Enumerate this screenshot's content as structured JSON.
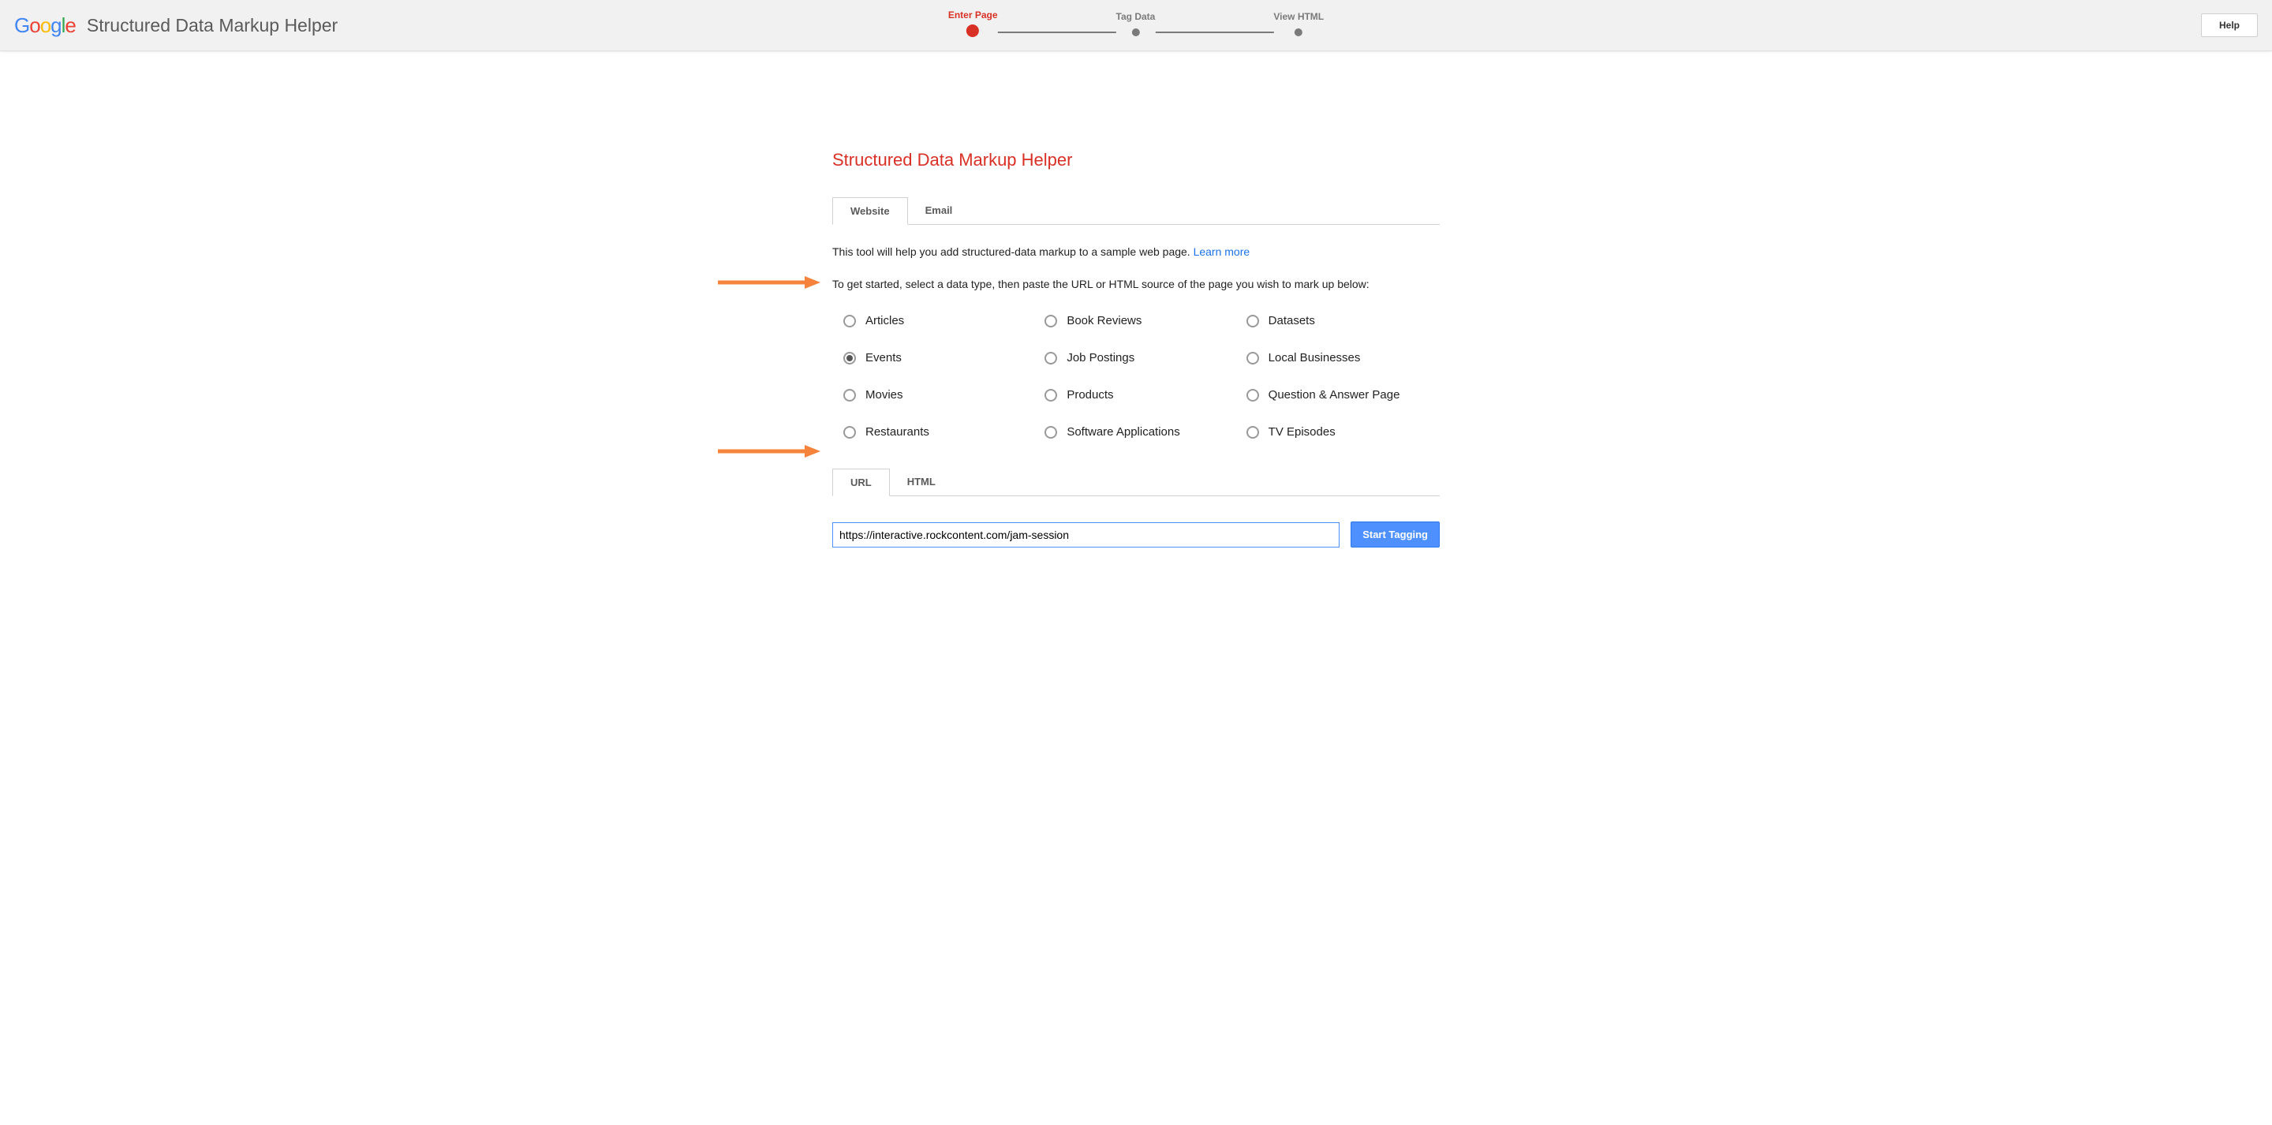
{
  "header": {
    "logo_text": "Google",
    "app_title": "Structured Data Markup Helper",
    "help_label": "Help"
  },
  "steps": [
    {
      "label": "Enter Page",
      "active": true
    },
    {
      "label": "Tag Data",
      "active": false
    },
    {
      "label": "View HTML",
      "active": false
    }
  ],
  "main": {
    "heading": "Structured Data Markup Helper",
    "tabs_content": [
      {
        "label": "Website",
        "active": true
      },
      {
        "label": "Email",
        "active": false
      }
    ],
    "intro_prefix": "This tool will help you add structured-data markup to a sample web page. ",
    "intro_link": "Learn more",
    "instructions": "To get started, select a data type, then paste the URL or HTML source of the page you wish to mark up below:",
    "data_types": [
      {
        "label": "Articles",
        "selected": false
      },
      {
        "label": "Book Reviews",
        "selected": false
      },
      {
        "label": "Datasets",
        "selected": false
      },
      {
        "label": "Events",
        "selected": true
      },
      {
        "label": "Job Postings",
        "selected": false
      },
      {
        "label": "Local Businesses",
        "selected": false
      },
      {
        "label": "Movies",
        "selected": false
      },
      {
        "label": "Products",
        "selected": false
      },
      {
        "label": "Question & Answer Page",
        "selected": false
      },
      {
        "label": "Restaurants",
        "selected": false
      },
      {
        "label": "Software Applications",
        "selected": false
      },
      {
        "label": "TV Episodes",
        "selected": false
      }
    ],
    "tabs_source": [
      {
        "label": "URL",
        "active": true
      },
      {
        "label": "HTML",
        "active": false
      }
    ],
    "url_value": "https://interactive.rockcontent.com/jam-session",
    "start_label": "Start Tagging"
  }
}
